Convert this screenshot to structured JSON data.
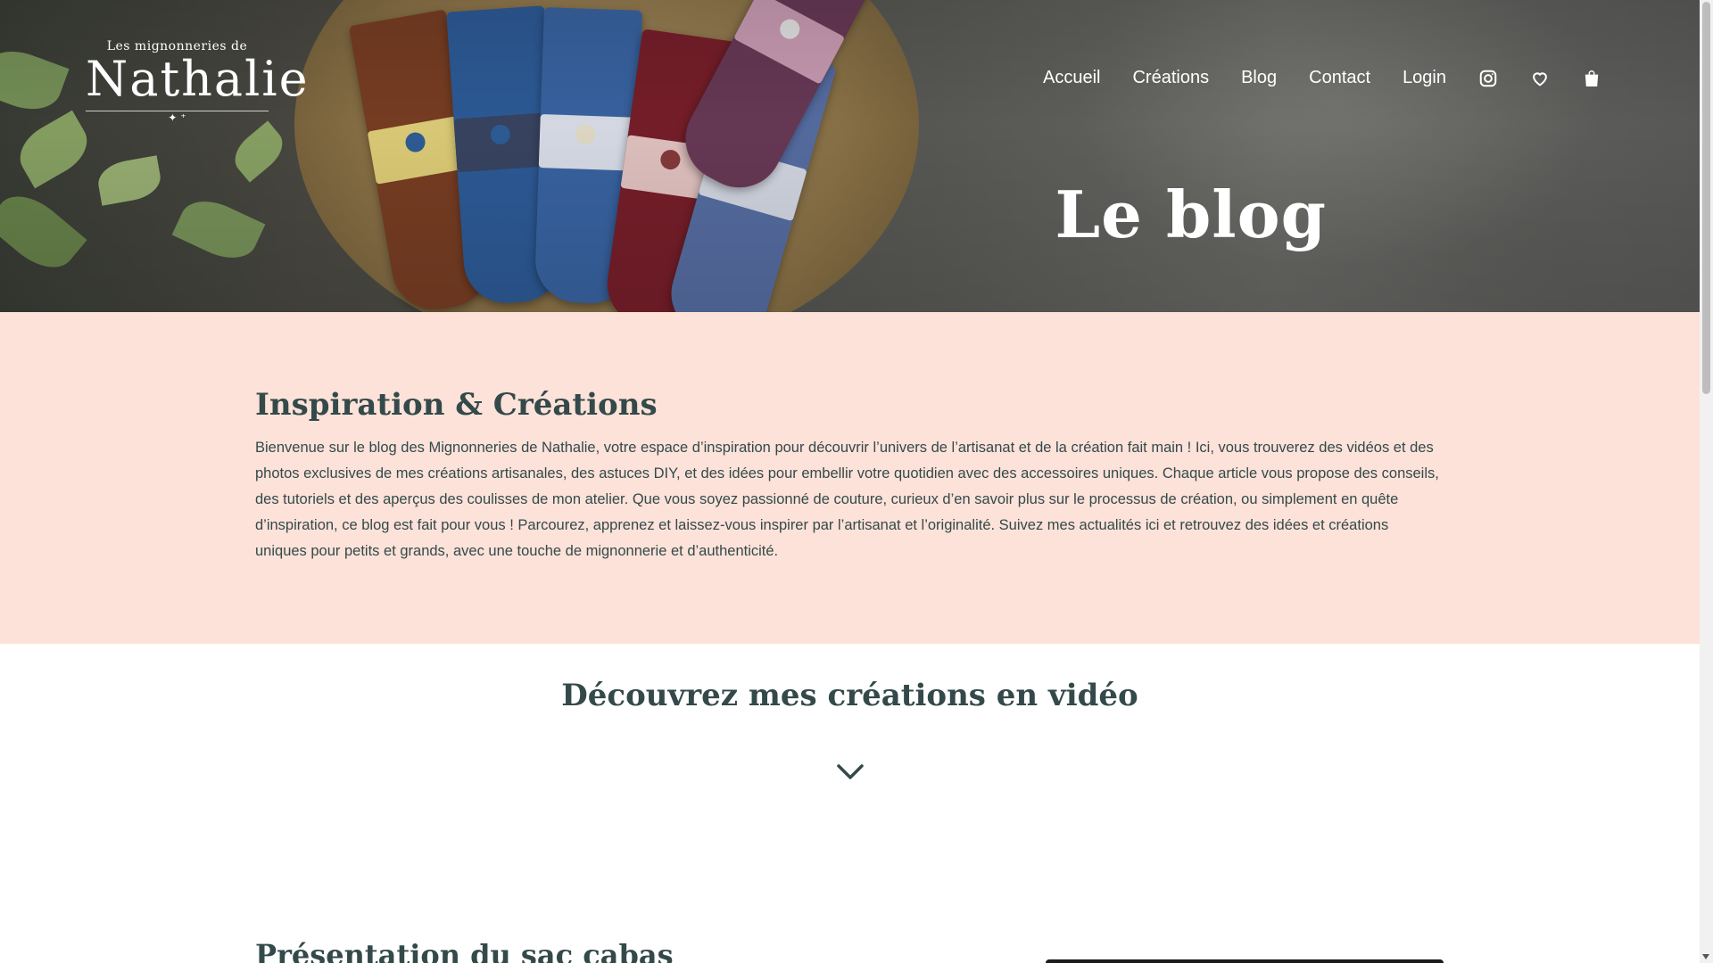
{
  "logo": {
    "top": "Les mignonneries de",
    "main": "Nathalie",
    "sparkle": "✦ ⁺"
  },
  "nav": {
    "items": [
      {
        "label": "Accueil"
      },
      {
        "label": "Créations"
      },
      {
        "label": "Blog"
      },
      {
        "label": "Contact"
      },
      {
        "label": "Login"
      }
    ],
    "icons": [
      "instagram-icon",
      "heart-icon",
      "shopping-bag-icon"
    ]
  },
  "hero": {
    "title": "Le blog"
  },
  "intro": {
    "heading": "Inspiration & Créations",
    "body": "Bienvenue sur le blog des Mignonneries de Nathalie, votre espace d’inspiration pour découvrir l’univers de l’artisanat et de la création fait main ! Ici, vous trouverez des vidéos et des photos exclusives de mes créations artisanales, des astuces DIY, et des idées pour embellir votre quotidien avec des accessoires uniques. Chaque article vous propose des conseils, des tutoriels et des aperçus des coulisses de mon atelier. Que vous soyez passionné de couture, curieux d’en savoir plus sur le processus de création, ou simplement en quête d’inspiration, ce blog est fait pour vous ! Parcourez, apprenez et laissez-vous inspirer par l’artisanat et l’originalité. Suivez mes actualités ici et retrouvez des idées et créations uniques pour petits et grands, avec une touche de mignonnerie et d’authenticité."
  },
  "video_section": {
    "heading": "Découvrez mes créations en vidéo",
    "first_item_heading": "Présentation du sac cabas"
  },
  "colors": {
    "accent_text": "#34494a",
    "intro_bg": "#fce2d9",
    "white": "#ffffff"
  }
}
